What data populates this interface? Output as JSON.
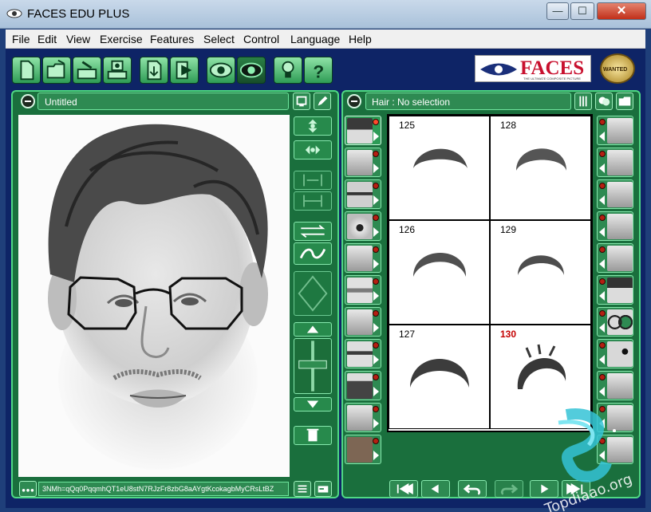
{
  "window": {
    "title": "FACES EDU PLUS",
    "min_glyph": "—",
    "max_glyph": "☐",
    "close_glyph": "✕"
  },
  "menu": [
    "File",
    "Edit",
    "View",
    "Exercise",
    "Features",
    "Select",
    "Control",
    "Language",
    "Help"
  ],
  "toolbar": {
    "buttons": [
      "new-icon",
      "open-icon",
      "save-icon",
      "print-icon",
      "import-icon",
      "export-icon",
      "eye-icon",
      "eye-dark-icon",
      "lightbulb-icon",
      "help-icon"
    ],
    "logo_text": "FACES",
    "logo_sub": "THE ULTIMATE COMPOSITE PICTURE",
    "badge_text": "WANTED"
  },
  "composite": {
    "title": "Untitled",
    "code": "3NMh=qQq0PqqmhQT1eU8stN7RJzFr8zbG8aAYgtKcokagbMyCRsLtBZ"
  },
  "browser": {
    "title": "Hair : No selection",
    "items": [
      {
        "number": "125",
        "highlight": false
      },
      {
        "number": "128",
        "highlight": false
      },
      {
        "number": "126",
        "highlight": false
      },
      {
        "number": "129",
        "highlight": false
      },
      {
        "number": "127",
        "highlight": false
      },
      {
        "number": "130",
        "highlight": true
      }
    ]
  },
  "left_features": [
    "hair-icon",
    "forehead-icon",
    "eyebrows-icon",
    "eyes-icon",
    "nose-icon",
    "lips-icon",
    "chin-icon",
    "mustache-icon",
    "beard-icon",
    "goatee-icon",
    "skin-tone-icon"
  ],
  "right_features": [
    "wrinkles-icon",
    "eye-bags-icon",
    "cheek-lines-icon",
    "mouth-lines-icon",
    "chin-lines-icon",
    "hat-icon",
    "glasses-icon",
    "mole-icon",
    "scar-icon",
    "earring-icon",
    "extra-icon"
  ],
  "watermark_text": "Topdiaao.org",
  "colors": {
    "panel": "#1a6f3d",
    "accent": "#4fd884",
    "background": "#0e2466"
  }
}
